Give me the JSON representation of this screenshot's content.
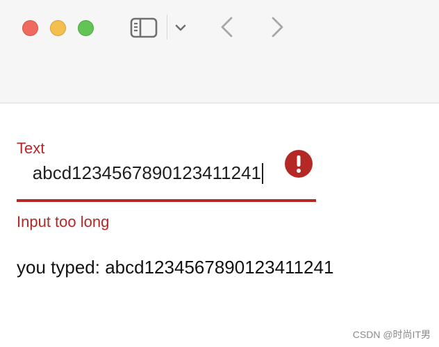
{
  "window": {
    "controls": [
      "close",
      "minimize",
      "zoom"
    ],
    "toolbar_icons": [
      "sidebar-toggle-icon",
      "chevron-down-icon",
      "back-chevron-icon",
      "forward-chevron-icon"
    ]
  },
  "form": {
    "label": "Text",
    "value": "abcd1234567890123411241",
    "error_message": "Input too long",
    "typed_prefix": "you typed:",
    "typed_value": "abcd1234567890123411241",
    "error_color": "#b42826"
  },
  "watermark": "CSDN @时尚IT男"
}
